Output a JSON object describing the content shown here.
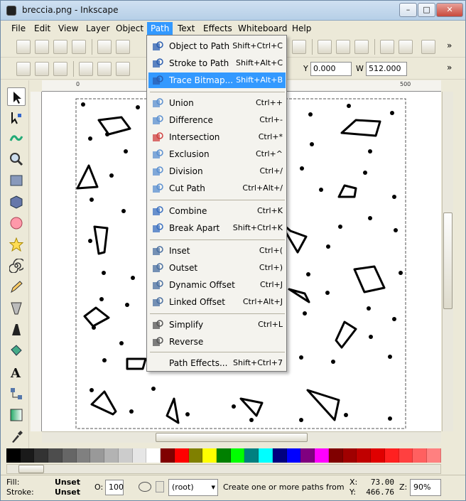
{
  "window": {
    "title": "breccia.png - Inkscape",
    "minimize": "–",
    "maximize": "□",
    "close": "✕"
  },
  "menubar": [
    "File",
    "Edit",
    "View",
    "Layer",
    "Object",
    "Path",
    "Text",
    "Effects",
    "Whiteboard",
    "Help"
  ],
  "toolbar2": {
    "y_label": "Y",
    "y_value": "0.000",
    "w_label": "W",
    "w_value": "512.000"
  },
  "ruler": {
    "zero": "0",
    "v500": "500"
  },
  "path_menu": {
    "items": [
      {
        "label": "Object to Path",
        "shortcut": "Shift+Ctrl+C",
        "icon": "object-to-path-icon"
      },
      {
        "label": "Stroke to Path",
        "shortcut": "Shift+Alt+C",
        "icon": "stroke-to-path-icon"
      },
      {
        "label": "Trace Bitmap...",
        "shortcut": "Shift+Alt+B",
        "icon": "trace-bitmap-icon"
      },
      {
        "label": "Union",
        "shortcut": "Ctrl++",
        "icon": "union-icon"
      },
      {
        "label": "Difference",
        "shortcut": "Ctrl+-",
        "icon": "difference-icon"
      },
      {
        "label": "Intersection",
        "shortcut": "Ctrl+*",
        "icon": "intersection-icon"
      },
      {
        "label": "Exclusion",
        "shortcut": "Ctrl+^",
        "icon": "exclusion-icon"
      },
      {
        "label": "Division",
        "shortcut": "Ctrl+/",
        "icon": "division-icon"
      },
      {
        "label": "Cut Path",
        "shortcut": "Ctrl+Alt+/",
        "icon": "cut-path-icon"
      },
      {
        "label": "Combine",
        "shortcut": "Ctrl+K",
        "icon": "combine-icon"
      },
      {
        "label": "Break Apart",
        "shortcut": "Shift+Ctrl+K",
        "icon": "break-apart-icon"
      },
      {
        "label": "Inset",
        "shortcut": "Ctrl+(",
        "icon": "inset-icon"
      },
      {
        "label": "Outset",
        "shortcut": "Ctrl+)",
        "icon": "outset-icon"
      },
      {
        "label": "Dynamic Offset",
        "shortcut": "Ctrl+J",
        "icon": "dynamic-offset-icon"
      },
      {
        "label": "Linked Offset",
        "shortcut": "Ctrl+Alt+J",
        "icon": "linked-offset-icon"
      },
      {
        "label": "Simplify",
        "shortcut": "Ctrl+L",
        "icon": "simplify-icon"
      },
      {
        "label": "Reverse",
        "shortcut": "",
        "icon": "reverse-icon"
      },
      {
        "label": "Path Effects...",
        "shortcut": "Shift+Ctrl+7",
        "icon": ""
      }
    ],
    "highlighted": "Trace Bitmap..."
  },
  "palette": [
    "#000000",
    "#1a1a1a",
    "#333333",
    "#4d4d4d",
    "#666666",
    "#808080",
    "#999999",
    "#b3b3b3",
    "#cccccc",
    "#e6e6e6",
    "#ffffff",
    "#800000",
    "#ff0000",
    "#808000",
    "#ffff00",
    "#008000",
    "#00ff00",
    "#008080",
    "#00ffff",
    "#000080",
    "#0000ff",
    "#800080",
    "#ff00ff",
    "#800000",
    "#a00000",
    "#c00000",
    "#e00000",
    "#ff2020",
    "#ff4040",
    "#ff6060",
    "#ff8080"
  ],
  "status": {
    "fill_label": "Fill:",
    "fill_value": "Unset",
    "stroke_label": "Stroke:",
    "stroke_value": "Unset",
    "opacity_label": "O:",
    "opacity_value": "100",
    "layer": "(root)",
    "message": "Create one or more paths from a",
    "x_label": "X:",
    "x_value": "73.00",
    "y_label": "Y:",
    "y_value": "466.76",
    "zoom_label": "Z:",
    "zoom_value": "90%"
  }
}
